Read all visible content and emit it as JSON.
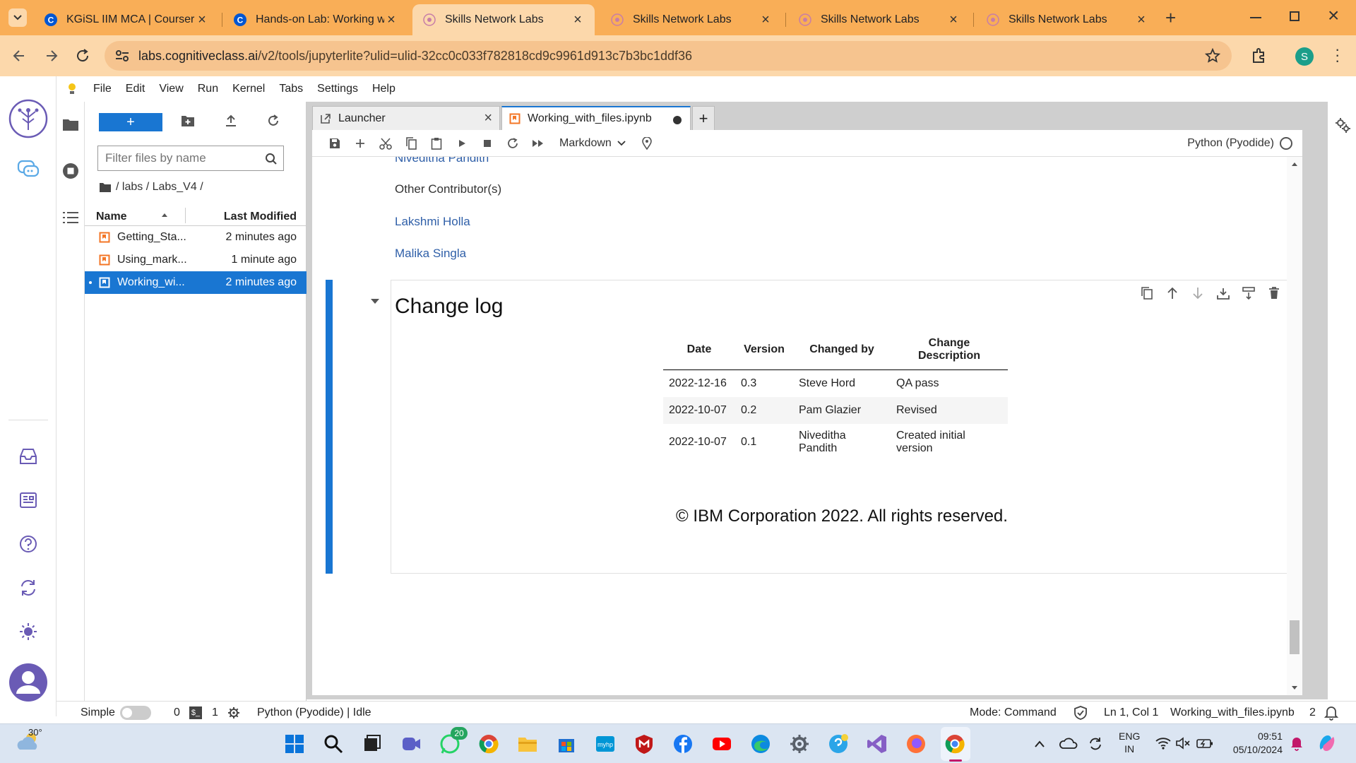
{
  "browser": {
    "tabs": [
      {
        "title": "KGiSL IIM MCA | Coursera",
        "active": false
      },
      {
        "title": "Hands-on Lab: Working wi",
        "active": false
      },
      {
        "title": "Skills Network Labs",
        "active": true
      },
      {
        "title": "Skills Network Labs",
        "active": false
      },
      {
        "title": "Skills Network Labs",
        "active": false
      },
      {
        "title": "Skills Network Labs",
        "active": false
      }
    ],
    "url_host": "labs.cognitiveclass.ai",
    "url_rest": "/v2/tools/jupyterlite?ulid=ulid-32cc0c033f782818cd9c9961d913c7b3bc1ddf36",
    "profile_initial": "S"
  },
  "menu": [
    "File",
    "Edit",
    "View",
    "Run",
    "Kernel",
    "Tabs",
    "Settings",
    "Help"
  ],
  "filebrowser": {
    "new_button": "+",
    "filter_placeholder": "Filter files by name",
    "breadcrumb": "/ labs / Labs_V4 /",
    "col_name": "Name",
    "col_modified": "Last Modified",
    "files": [
      {
        "name": "Getting_Sta...",
        "modified": "2 minutes ago",
        "selected": false
      },
      {
        "name": "Using_mark...",
        "modified": "1 minute ago",
        "selected": false
      },
      {
        "name": "Working_wi...",
        "modified": "2 minutes ago",
        "selected": true
      }
    ]
  },
  "notebook": {
    "tabs": [
      {
        "label": "Launcher",
        "active": false
      },
      {
        "label": "Working_with_files.ipynb",
        "active": true
      }
    ],
    "cell_type": "Markdown",
    "kernel": "Python (Pyodide)",
    "partial_author": "Niveditha Pandith",
    "other_contributors_heading": "Other Contributor(s)",
    "contributors": [
      "Lakshmi Holla",
      "Malika Singla"
    ],
    "changelog_heading": "Change log",
    "changelog_columns": [
      "Date",
      "Version",
      "Changed by",
      "Change Description"
    ],
    "changelog_rows": [
      [
        "2022-12-16",
        "0.3",
        "Steve Hord",
        "QA pass"
      ],
      [
        "2022-10-07",
        "0.2",
        "Pam Glazier",
        "Revised"
      ],
      [
        "2022-10-07",
        "0.1",
        "Niveditha Pandith",
        "Created initial version"
      ]
    ],
    "copyright": "© IBM Corporation 2022. All rights reserved."
  },
  "statusbar": {
    "simple_label": "Simple",
    "terminals": "0",
    "kernels": "1",
    "kernel_status": "Python (Pyodide) | Idle",
    "mode": "Mode: Command",
    "cursor": "Ln 1, Col 1",
    "filename": "Working_with_files.ipynb",
    "notifications": "2"
  },
  "taskbar": {
    "temperature": "30°",
    "whatsapp_badge": "20",
    "language_line1": "ENG",
    "language_line2": "IN",
    "time": "09:51",
    "date": "05/10/2024"
  },
  "colors": {
    "tabstrip": "#f9ae57",
    "toolbar": "#fcd8ab",
    "jupyter_blue": "#1976d2",
    "link": "#2f5fa8"
  }
}
